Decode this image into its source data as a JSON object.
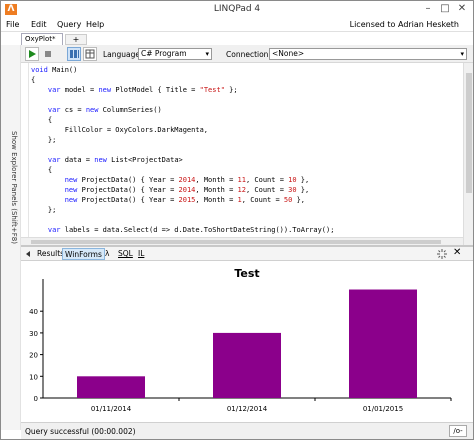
{
  "window": {
    "title": "LINQPad 4",
    "app_icon": "linqpad-icon",
    "controls": [
      "minimize-icon",
      "maximize-icon",
      "close-icon"
    ]
  },
  "menu": {
    "items": [
      "File",
      "Edit",
      "Query",
      "Help"
    ],
    "license": "Licensed to Adrian Hesketh"
  },
  "tabs": {
    "query_tab": "OxyPlot*",
    "add_tab": "+"
  },
  "sidebar": {
    "label": "Show Explorer Panels (Shift+F8)"
  },
  "toolbar": {
    "language_label": "Language",
    "language_value": "C# Program",
    "connection_label": "Connection",
    "connection_value": "<None>",
    "icons": [
      "run-icon",
      "stop-icon",
      "grid-results-icon",
      "text-results-icon"
    ]
  },
  "editor": {
    "lines": [
      [
        {
          "t": "void",
          "c": "kw"
        },
        {
          "t": " Main()",
          "c": ""
        }
      ],
      [
        {
          "t": "{",
          "c": ""
        }
      ],
      [
        {
          "t": "    ",
          "c": ""
        },
        {
          "t": "var",
          "c": "kw"
        },
        {
          "t": " model = ",
          "c": ""
        },
        {
          "t": "new",
          "c": "kw"
        },
        {
          "t": " PlotModel { Title = ",
          "c": ""
        },
        {
          "t": "\"Test\"",
          "c": "str"
        },
        {
          "t": " };",
          "c": ""
        }
      ],
      [
        {
          "t": "",
          "c": ""
        }
      ],
      [
        {
          "t": "    ",
          "c": ""
        },
        {
          "t": "var",
          "c": "kw"
        },
        {
          "t": " cs = ",
          "c": ""
        },
        {
          "t": "new",
          "c": "kw"
        },
        {
          "t": " ColumnSeries()",
          "c": ""
        }
      ],
      [
        {
          "t": "    {",
          "c": ""
        }
      ],
      [
        {
          "t": "        FillColor = OxyColors.DarkMagenta,",
          "c": ""
        }
      ],
      [
        {
          "t": "    };",
          "c": ""
        }
      ],
      [
        {
          "t": "",
          "c": ""
        }
      ],
      [
        {
          "t": "    ",
          "c": ""
        },
        {
          "t": "var",
          "c": "kw"
        },
        {
          "t": " data = ",
          "c": ""
        },
        {
          "t": "new",
          "c": "kw"
        },
        {
          "t": " List<ProjectData>",
          "c": ""
        }
      ],
      [
        {
          "t": "    {",
          "c": ""
        }
      ],
      [
        {
          "t": "        ",
          "c": ""
        },
        {
          "t": "new",
          "c": "kw"
        },
        {
          "t": " ProjectData() { Year = ",
          "c": ""
        },
        {
          "t": "2014",
          "c": "num"
        },
        {
          "t": ", Month = ",
          "c": ""
        },
        {
          "t": "11",
          "c": "num"
        },
        {
          "t": ", Count = ",
          "c": ""
        },
        {
          "t": "10",
          "c": "num"
        },
        {
          "t": " },",
          "c": ""
        }
      ],
      [
        {
          "t": "        ",
          "c": ""
        },
        {
          "t": "new",
          "c": "kw"
        },
        {
          "t": " ProjectData() { Year = ",
          "c": ""
        },
        {
          "t": "2014",
          "c": "num"
        },
        {
          "t": ", Month = ",
          "c": ""
        },
        {
          "t": "12",
          "c": "num"
        },
        {
          "t": ", Count = ",
          "c": ""
        },
        {
          "t": "30",
          "c": "num"
        },
        {
          "t": " },",
          "c": ""
        }
      ],
      [
        {
          "t": "        ",
          "c": ""
        },
        {
          "t": "new",
          "c": "kw"
        },
        {
          "t": " ProjectData() { Year = ",
          "c": ""
        },
        {
          "t": "2015",
          "c": "num"
        },
        {
          "t": ", Month = ",
          "c": ""
        },
        {
          "t": "1",
          "c": "num"
        },
        {
          "t": ", Count = ",
          "c": ""
        },
        {
          "t": "50",
          "c": "num"
        },
        {
          "t": " },",
          "c": ""
        }
      ],
      [
        {
          "t": "    };",
          "c": ""
        }
      ],
      [
        {
          "t": "",
          "c": ""
        }
      ],
      [
        {
          "t": "    ",
          "c": ""
        },
        {
          "t": "var",
          "c": "kw"
        },
        {
          "t": " labels = data.Select(d => d.Date.ToShortDateString()).ToArray();",
          "c": ""
        }
      ]
    ]
  },
  "results_tabs": {
    "items": [
      {
        "label": "Results",
        "active": false
      },
      {
        "label": "WinForms",
        "active": true
      },
      {
        "label": "λ",
        "active": false
      },
      {
        "label": "SQL",
        "active": false
      },
      {
        "label": "IL",
        "active": false
      }
    ],
    "icons": [
      "loading-icon",
      "close-icon"
    ]
  },
  "chart_data": {
    "type": "bar",
    "title": "Test",
    "categories": [
      "01/11/2014",
      "01/12/2014",
      "01/01/2015"
    ],
    "values": [
      10,
      30,
      50
    ],
    "ylim": [
      0,
      53
    ],
    "yticks": [
      0,
      10,
      20,
      30,
      40
    ],
    "grid": false,
    "legend": "none",
    "color": "#8B008B"
  },
  "status": {
    "text": "Query successful  (00:00.002)",
    "button": "/o-"
  }
}
